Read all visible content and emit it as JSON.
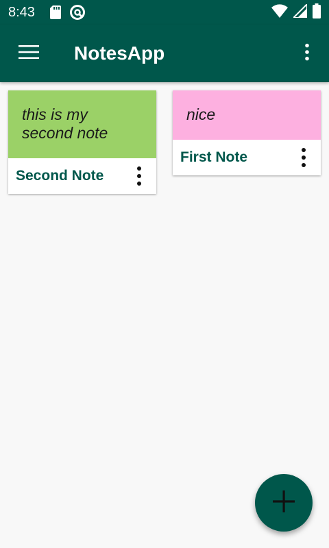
{
  "status_bar": {
    "time": "8:43",
    "icons": [
      "sd-card-icon",
      "do-not-disturb-icon",
      "wifi-icon",
      "signal-icon",
      "battery-icon"
    ]
  },
  "app_bar": {
    "title": "NotesApp",
    "menu_icon": "hamburger-menu-icon",
    "overflow_icon": "more-vert-icon"
  },
  "notes": [
    {
      "title": "Second Note",
      "body": "this is my second note",
      "color": "#9bd167"
    },
    {
      "title": "First Note",
      "body": "nice",
      "color": "#fdb0e0"
    }
  ],
  "fab": {
    "icon": "add-icon"
  },
  "colors": {
    "primary": "#00574b",
    "background": "#f8f8f8"
  }
}
